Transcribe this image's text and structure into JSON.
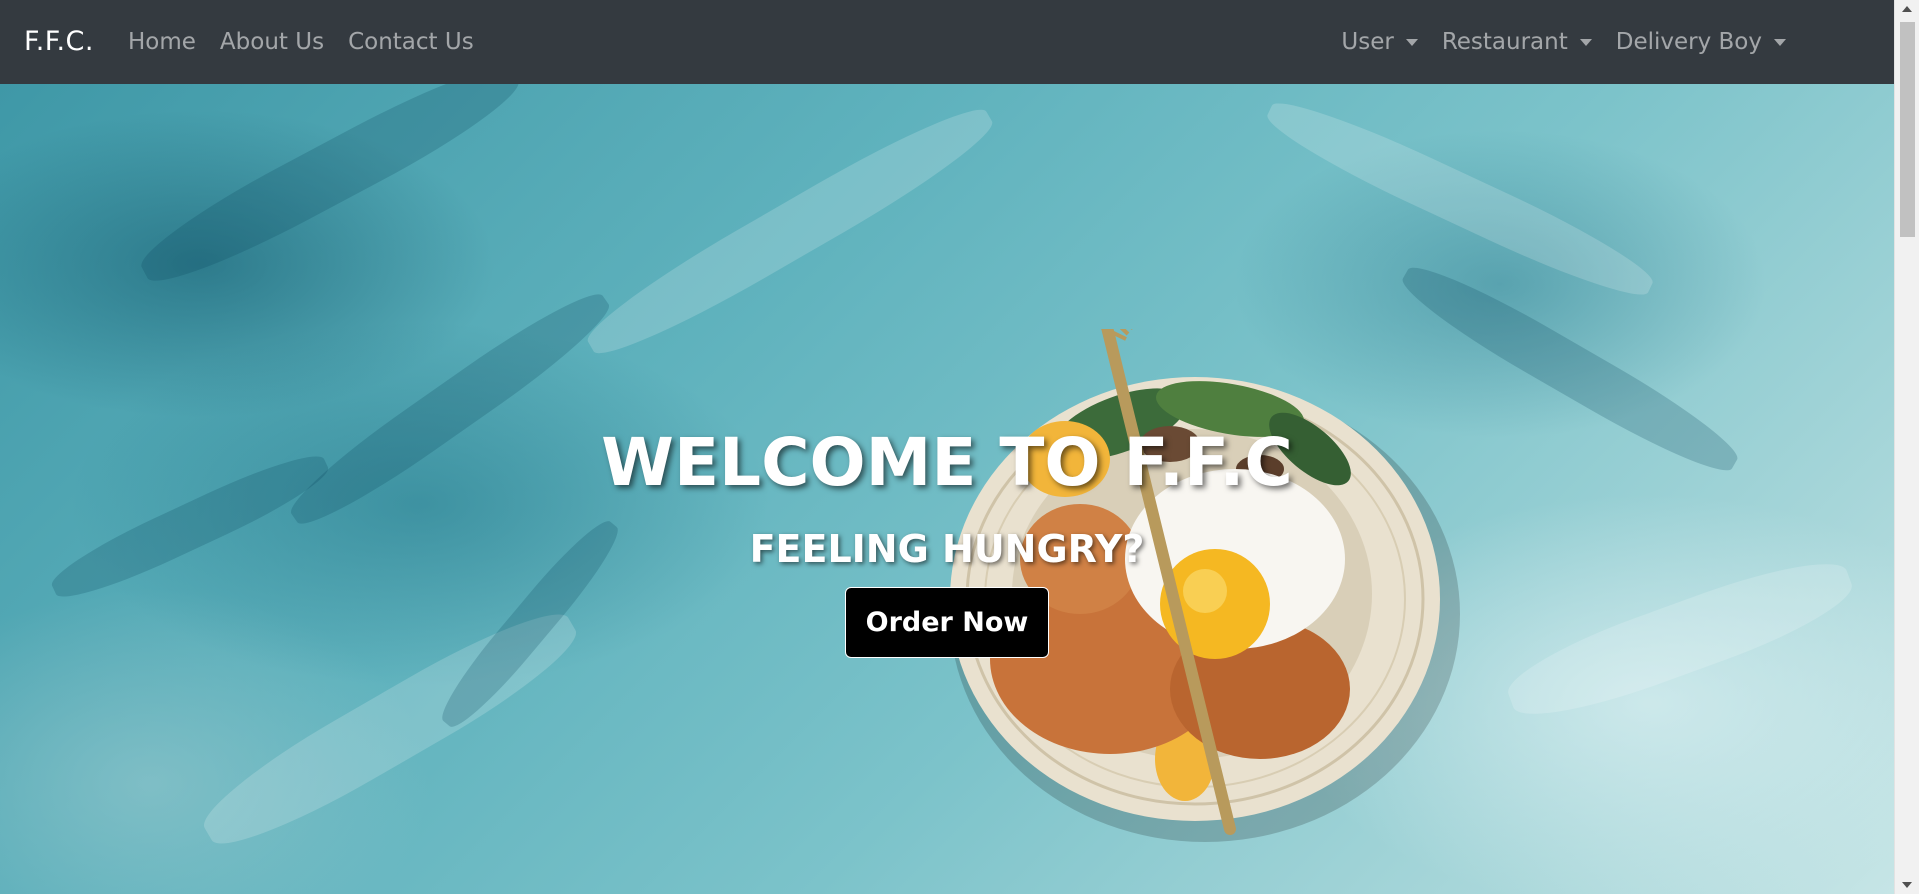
{
  "navbar": {
    "brand": "F.F.C.",
    "links": [
      "Home",
      "About Us",
      "Contact Us"
    ],
    "dropdowns": [
      "User",
      "Restaurant",
      "Delivery Boy"
    ]
  },
  "hero": {
    "title": "WELCOME TO F.F.C",
    "subtitle": "FEELING HUNGRY?",
    "cta_label": "Order Now",
    "background_image": "food-bowl-on-teal-painted-table"
  },
  "colors": {
    "navbar_bg": "#343a40",
    "nav_text": "#8c8f93",
    "hero_teal": "#5fb2bd",
    "button_bg": "#000000"
  }
}
